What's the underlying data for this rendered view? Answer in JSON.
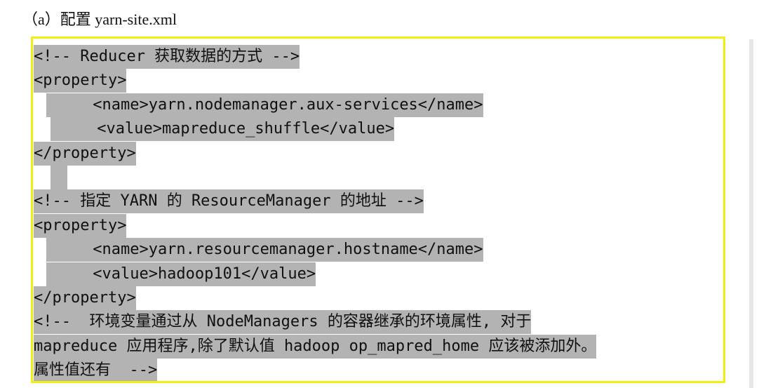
{
  "heading": "（a）配置 yarn-site.xml",
  "lines": [
    "<!-- Reducer 获取数据的方式 -->",
    "<property>",
    "     <name>yarn.nodemanager.aux-services</name>",
    "     <value>mapreduce_shuffle</value>",
    "</property>",
    "",
    "<!-- 指定 YARN 的 ResourceManager 的地址 -->",
    "<property>",
    "     <name>yarn.resourcemanager.hostname</name>",
    "     <value>hadoop101</value>",
    "</property>",
    "<!--  环境变量通过从 NodeManagers 的容器继承的环境属性, 对于",
    "mapreduce 应用程序,除了默认值 hadoop op_mapred_home 应该被添加外。",
    "属性值还有  -->"
  ]
}
